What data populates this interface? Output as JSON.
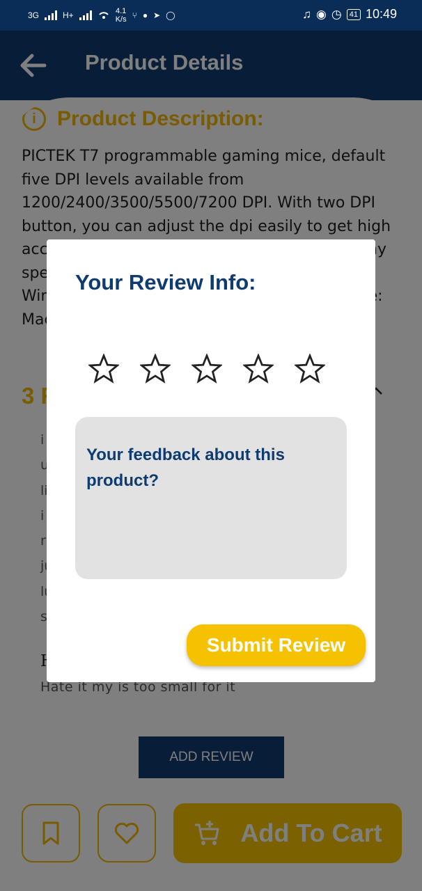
{
  "status_bar": {
    "network": "3G",
    "network2": "H+",
    "speed_value": "4.1",
    "speed_unit": "K/s",
    "battery": "41",
    "time": "10:49"
  },
  "header": {
    "title": "Product Details"
  },
  "description": {
    "title": "Product Description:",
    "text": "PICTEK T7 programmable gaming mice, default five DPI levels available from 1200/2400/3500/5500/7200 DPI. With two DPI button, you can adjust the dpi easily to get high accuracy for your gaming. Compatible with any specific operating system like Windows XP, Windows 8, Windows 10, Mac OS, Linux ( Note: Macro function is only for windows system)"
  },
  "reviews": {
    "heading": "3 Reviews",
    "first_lines": [
      "i",
      "u",
      "li",
      "i",
      "r",
      "ju",
      "lu",
      "s"
    ],
    "second_title": "H",
    "second_body": "Hate it my is too small for it"
  },
  "add_review_label": "ADD REVIEW",
  "add_to_cart_label": "Add To Cart",
  "dialog": {
    "title": "Your Review Info:",
    "stars": [
      "star-1",
      "star-2",
      "star-3",
      "star-4",
      "star-5"
    ],
    "rating": 0,
    "feedback_placeholder": "Your feedback about this product?",
    "submit_label": "Submit Review"
  },
  "colors": {
    "primary": "#0e3b70",
    "accent": "#f6c200",
    "accent_text": "#f2b705"
  }
}
